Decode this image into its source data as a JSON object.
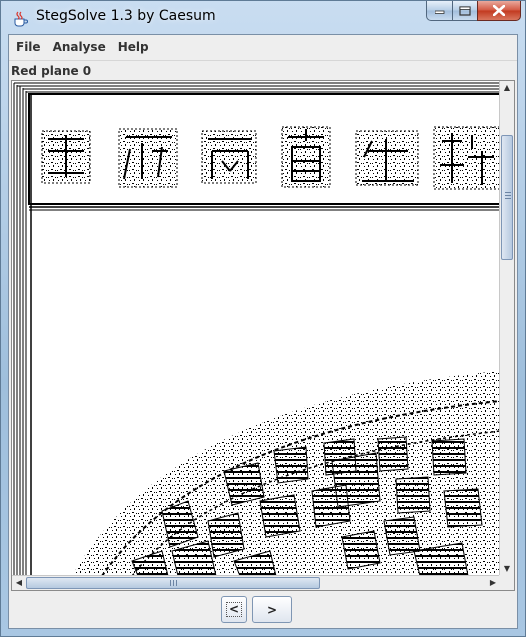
{
  "window": {
    "title": "StegSolve 1.3 by Caesum",
    "app_icon": "java-cup-icon",
    "buttons": [
      "minimize-icon",
      "maximize-icon",
      "close-icon"
    ]
  },
  "menu": {
    "items": [
      "File",
      "Analyse",
      "Help"
    ]
  },
  "view": {
    "plane_label": "Red plane 0"
  },
  "nav": {
    "prev_label": "<",
    "next_label": ">"
  },
  "scrollbars": {
    "vertical_up": "▲",
    "vertical_down": "▼",
    "horizontal_left": "◀",
    "horizontal_right": "▶"
  },
  "colors": {
    "accent": "#3a6ea5",
    "close": "#c23a20"
  }
}
